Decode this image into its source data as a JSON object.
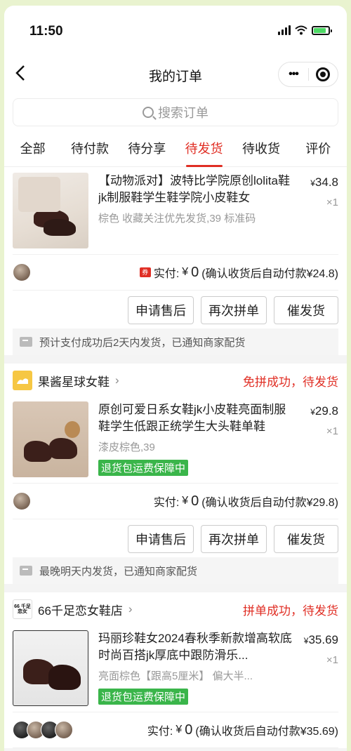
{
  "status_bar": {
    "time": "11:50"
  },
  "nav": {
    "back_icon": "chevron-left-icon",
    "title": "我的订单",
    "more_icon": "more-dots-icon",
    "close_icon": "target-icon"
  },
  "search": {
    "placeholder": "搜索订单"
  },
  "tabs": [
    {
      "label": "全部",
      "active": false
    },
    {
      "label": "待付款",
      "active": false
    },
    {
      "label": "待分享",
      "active": false
    },
    {
      "label": "待发货",
      "active": true
    },
    {
      "label": "待收货",
      "active": false
    },
    {
      "label": "评价",
      "active": false
    }
  ],
  "colors": {
    "accent": "#e02e24",
    "green": "#3ab54a",
    "background": "#e9f3cf"
  },
  "orders": [
    {
      "item": {
        "title": "【动物派对】波特比学院原创lolita鞋jk制服鞋学生鞋学院小皮鞋女",
        "spec": "棕色 收藏关注优先发货,39 标准码",
        "price_symbol": "¥",
        "price": "34.8",
        "qty": "×1"
      },
      "pay": {
        "coupon_icon": "券",
        "label": "实付:",
        "symbol": "¥",
        "amount": "0",
        "note": "(确认收货后自动付款¥24.8)"
      },
      "buttons": [
        "申请售后",
        "再次拼单",
        "催发货"
      ],
      "notice": "预计支付成功后2天内发货，已通知商家配货"
    },
    {
      "shop": {
        "name": "果酱星球女鞋",
        "status": "免拼成功，待发货"
      },
      "item": {
        "title": "原创可爱日系女鞋jk小皮鞋亮面制服鞋学生低跟正统学生大头鞋单鞋",
        "spec": "漆皮棕色,39",
        "badge": "退货包运费保障中",
        "price_symbol": "¥",
        "price": "29.8",
        "qty": "×1"
      },
      "pay": {
        "label": "实付:",
        "symbol": "¥",
        "amount": "0",
        "note": "(确认收货后自动付款¥29.8)"
      },
      "buttons": [
        "申请售后",
        "再次拼单",
        "催发货"
      ],
      "notice": "最晚明天内发货，已通知商家配货"
    },
    {
      "shop": {
        "name": "66千足恋女鞋店",
        "logo_text": "66 千足恋女",
        "status": "拼单成功，待发货"
      },
      "item": {
        "title": "玛丽珍鞋女2024春秋季新款增高软底时尚百搭jk厚底中跟防滑乐...",
        "spec": "亮面棕色【跟高5厘米】 偏大半...",
        "badge": "退货包运费保障中",
        "price_symbol": "¥",
        "price": "35.69",
        "qty": "×1"
      },
      "pay": {
        "label": "实付:",
        "symbol": "¥",
        "amount": "0",
        "note": "(确认收货后自动付款¥35.69)"
      }
    }
  ]
}
